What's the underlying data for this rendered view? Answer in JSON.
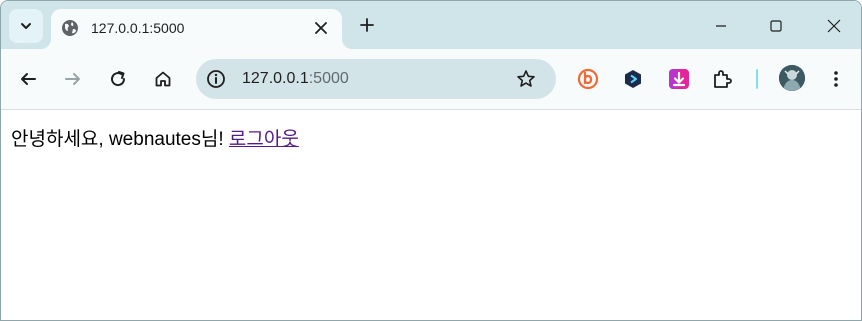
{
  "tab": {
    "title": "127.0.0.1:5000",
    "favicon": "globe-icon"
  },
  "omnibox": {
    "host": "127.0.0.1",
    "port": ":5000"
  },
  "extensions": [
    {
      "name": "b-logo-extension-icon",
      "color": "#f06a35"
    },
    {
      "name": "hexagon-extension-icon",
      "color": "#1b2b4a"
    },
    {
      "name": "download-extension-icon",
      "color": "#e3259b"
    },
    {
      "name": "puzzle-extensions-icon",
      "color": "#1f1f1f"
    }
  ],
  "page": {
    "greeting": "안녕하세요, webnautes님! ",
    "logout_link": "로그아웃"
  },
  "colors": {
    "tabstrip_bg": "#cfe5ea",
    "toolbar_bg": "#f7fbfc",
    "omnibox_bg": "#d3e4e9",
    "visited_link": "#551a8b"
  }
}
